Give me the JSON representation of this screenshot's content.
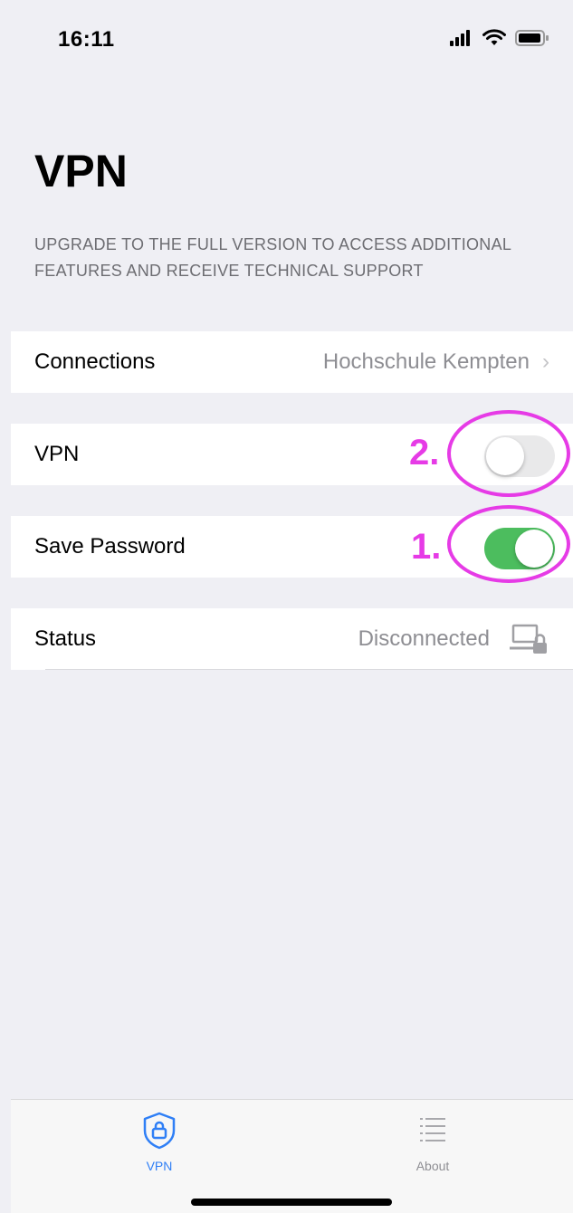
{
  "status_bar": {
    "time": "16:11"
  },
  "header": {
    "title": "VPN"
  },
  "banner": {
    "text": "UPGRADE TO THE FULL VERSION TO ACCESS ADDITIONAL FEATURES AND RECEIVE TECHNICAL SUPPORT"
  },
  "rows": {
    "connections": {
      "label": "Connections",
      "value": "Hochschule Kempten"
    },
    "vpn": {
      "label": "VPN",
      "enabled": false
    },
    "save_password": {
      "label": "Save Password",
      "enabled": true
    },
    "status": {
      "label": "Status",
      "value": "Disconnected"
    }
  },
  "annotations": {
    "first": "1.",
    "second": "2.",
    "color": "#e63be6"
  },
  "tab_bar": {
    "tabs": [
      {
        "label": "VPN",
        "active": true
      },
      {
        "label": "About",
        "active": false
      }
    ]
  },
  "colors": {
    "accent": "#2f7ff6",
    "toggle_on": "#4cbd5e",
    "toggle_off": "#e9e9ea",
    "secondary_text": "#8e8e93",
    "background": "#efeff4"
  },
  "icons": {
    "connections_chevron": "chevron-right-icon",
    "status_icon": "computer-lock-icon",
    "vpn_tab_icon": "shield-lock-icon",
    "about_tab_icon": "list-icon"
  }
}
